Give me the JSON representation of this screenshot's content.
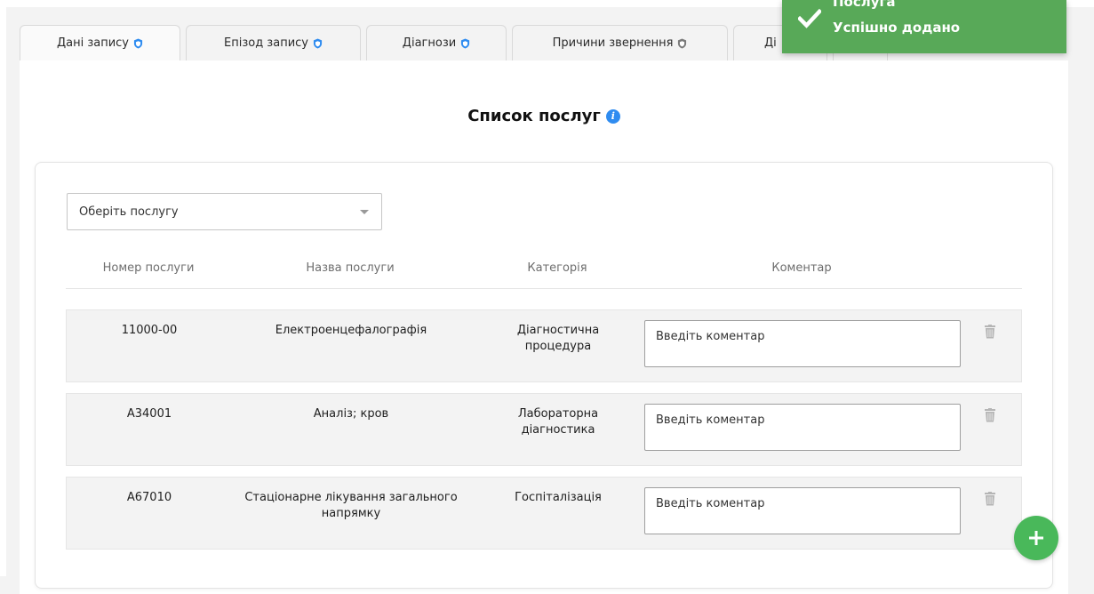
{
  "tabs": [
    {
      "label": "Дані запису",
      "icon": "shield-blue-icon"
    },
    {
      "label": "Епізод запису",
      "icon": "shield-blue-icon"
    },
    {
      "label": "Діагнози",
      "icon": "shield-blue-icon"
    },
    {
      "label": "Причини звернення",
      "icon": "shield-gray-icon"
    },
    {
      "label": "Ді",
      "icon": ""
    },
    {
      "label": "",
      "icon": ""
    }
  ],
  "page": {
    "title": "Список послуг",
    "title_icon": "info-icon"
  },
  "service_select": {
    "placeholder": "Оберіть послугу"
  },
  "table": {
    "headers": [
      "Номер послуги",
      "Назва послуги",
      "Категорія",
      "Коментар"
    ],
    "rows": [
      {
        "number": "11000-00",
        "name": "Електроенцефалографія",
        "category": "Діагностична процедура",
        "comment_placeholder": "Введіть коментар"
      },
      {
        "number": "А34001",
        "name": "Аналіз; кров",
        "category": "Лабораторна діагностика",
        "comment_placeholder": "Введіть коментар"
      },
      {
        "number": "А67010",
        "name": "Стаціонарне лікування загального напрямку",
        "category": "Госпіталізація",
        "comment_placeholder": "Введіть коментар"
      }
    ]
  },
  "toast": {
    "title": "Послуга",
    "message": "Успішно додано",
    "color": "#58a958"
  },
  "colors": {
    "accent_blue": "#2f8cf0",
    "fab_green": "#49b85a"
  }
}
